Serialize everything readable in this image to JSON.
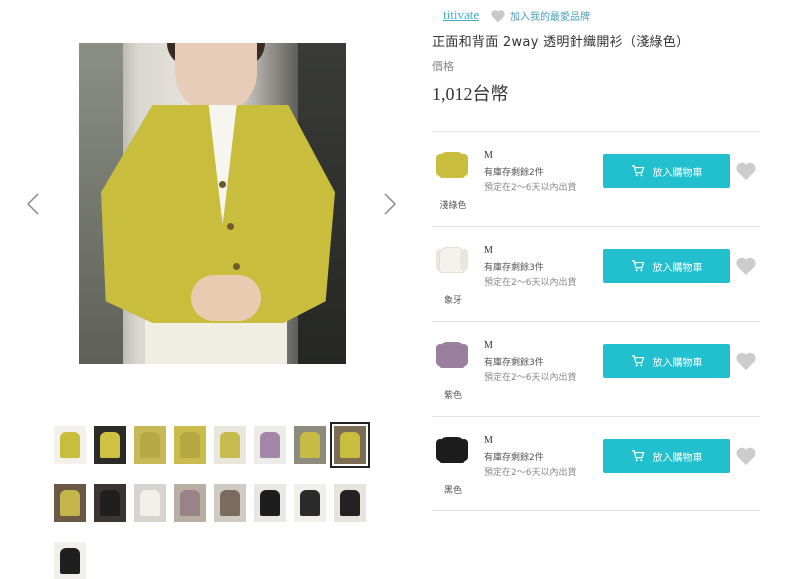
{
  "gallery": {
    "prev_label": "previous image",
    "next_label": "next image",
    "thumbnails": [
      {
        "bg": "#f3f1ea",
        "fig": "#c9bd3e"
      },
      {
        "bg": "#2d2b27",
        "fig": "#d0c243"
      },
      {
        "bg": "#c7b957",
        "fig": "#b7aa45"
      },
      {
        "bg": "#c9bc4c",
        "fig": "#b4a842"
      },
      {
        "bg": "#e9e6dc",
        "fig": "#c6bb4c"
      },
      {
        "bg": "#ecebe8",
        "fig": "#a487a8"
      },
      {
        "bg": "#8d8a7e",
        "fig": "#c8bb45"
      },
      {
        "bg": "#7a6c55",
        "fig": "#c9bd3e"
      },
      {
        "bg": "#6a5a45",
        "fig": "#c3b54a"
      },
      {
        "bg": "#3b3532",
        "fig": "#1f1f1f"
      },
      {
        "bg": "#d7d4cf",
        "fig": "#f2f0ea"
      },
      {
        "bg": "#b8aea2",
        "fig": "#9a8289"
      },
      {
        "bg": "#cfcbc3",
        "fig": "#7c6a5e"
      },
      {
        "bg": "#e9e7e1",
        "fig": "#1d1d1d"
      },
      {
        "bg": "#f1efe9",
        "fig": "#2b2b2b"
      },
      {
        "bg": "#e7e4de",
        "fig": "#222222"
      },
      {
        "bg": "#f2f0ec",
        "fig": "#1f1f1f"
      }
    ],
    "selected_index": 7
  },
  "product": {
    "brand": "titivate",
    "favorite_brand_label": "加入我的最愛品牌",
    "title": "正面和背面 2way 透明針織開衫（淺綠色）",
    "price_label": "價格",
    "price": "1,012台幣"
  },
  "variants": [
    {
      "color_name": "淺綠色",
      "swatch": "#c9bd3e",
      "size": "M",
      "stock": "有庫存剩餘2件",
      "ship": "預定在2～6天以內出貨",
      "cart_label": "放入購物車"
    },
    {
      "color_name": "象牙",
      "swatch": "#f4f2ea",
      "size": "M",
      "stock": "有庫存剩餘3件",
      "ship": "預定在2～6天以內出貨",
      "cart_label": "放入購物車"
    },
    {
      "color_name": "紫色",
      "swatch": "#9a7f9f",
      "size": "M",
      "stock": "有庫存剩餘3件",
      "ship": "預定在2～6天以內出貨",
      "cart_label": "放入購物車"
    },
    {
      "color_name": "黑色",
      "swatch": "#1c1c1c",
      "size": "M",
      "stock": "有庫存剩餘2件",
      "ship": "預定在2～6天以內出貨",
      "cart_label": "放入購物車"
    }
  ],
  "colors": {
    "accent": "#22bfcf",
    "brand_link": "#3fb0c8",
    "heart": "#cccccc"
  }
}
